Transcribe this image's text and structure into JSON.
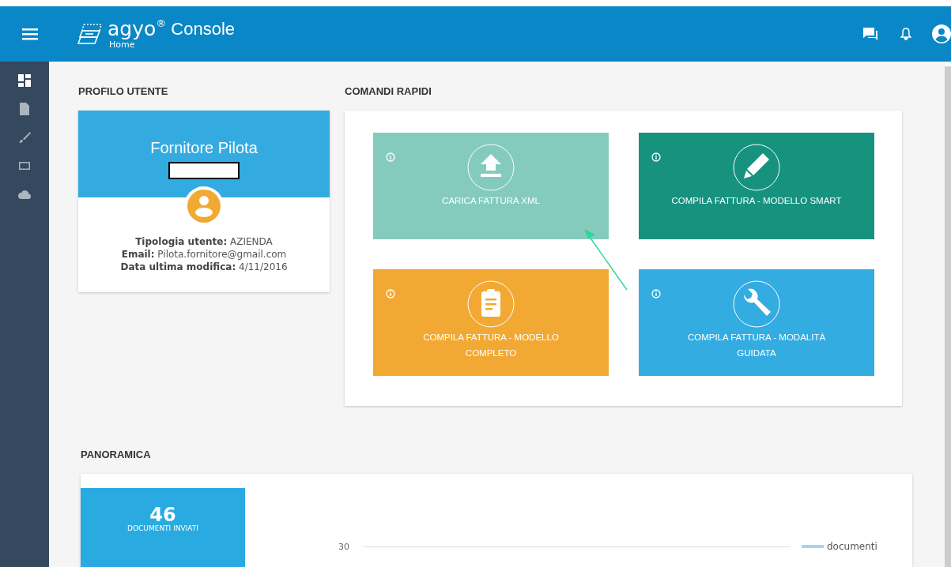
{
  "header": {
    "logo": "agyo",
    "logo_mark": "®",
    "title": "Console",
    "subtitle": "Home"
  },
  "sidebar": {
    "items": [
      {
        "kind": "dashboard",
        "selected": true
      },
      {
        "kind": "document",
        "selected": false
      },
      {
        "kind": "brush",
        "selected": false
      },
      {
        "kind": "screen",
        "selected": false
      },
      {
        "kind": "upload",
        "selected": false
      }
    ]
  },
  "profile": {
    "heading": "PROFILO UTENTE",
    "name": "Fornitore Pilota",
    "details": [
      {
        "label": "Tipologia utente:",
        "value": "AZIENDA"
      },
      {
        "label": "Email:",
        "value": "Pilota.fornitore@gmail.com"
      },
      {
        "label": "Data ultima modifica:",
        "value": "4/11/2016"
      }
    ]
  },
  "quick_commands": {
    "heading": "COMANDI RAPIDI",
    "tiles": [
      {
        "label": "CARICA FATTURA XML",
        "kind": "upload",
        "color": "#84cbbd"
      },
      {
        "label": "COMPILA FATTURA - MODELLO SMART",
        "kind": "pencil",
        "color": "#16927f"
      },
      {
        "label": "COMPILA FATTURA - MODELLO COMPLETO",
        "kind": "clipboard",
        "color": "#f2a933"
      },
      {
        "label": "COMPILA FATTURA - MODALITÀ GUIDATA",
        "kind": "wrench",
        "color": "#33ace2"
      }
    ]
  },
  "overview": {
    "heading": "PANORAMICA",
    "stat": {
      "value": "46",
      "label": "DOCUMENTI INVIATI"
    },
    "chart": {
      "tick_label": "30",
      "legend": "documenti"
    }
  }
}
